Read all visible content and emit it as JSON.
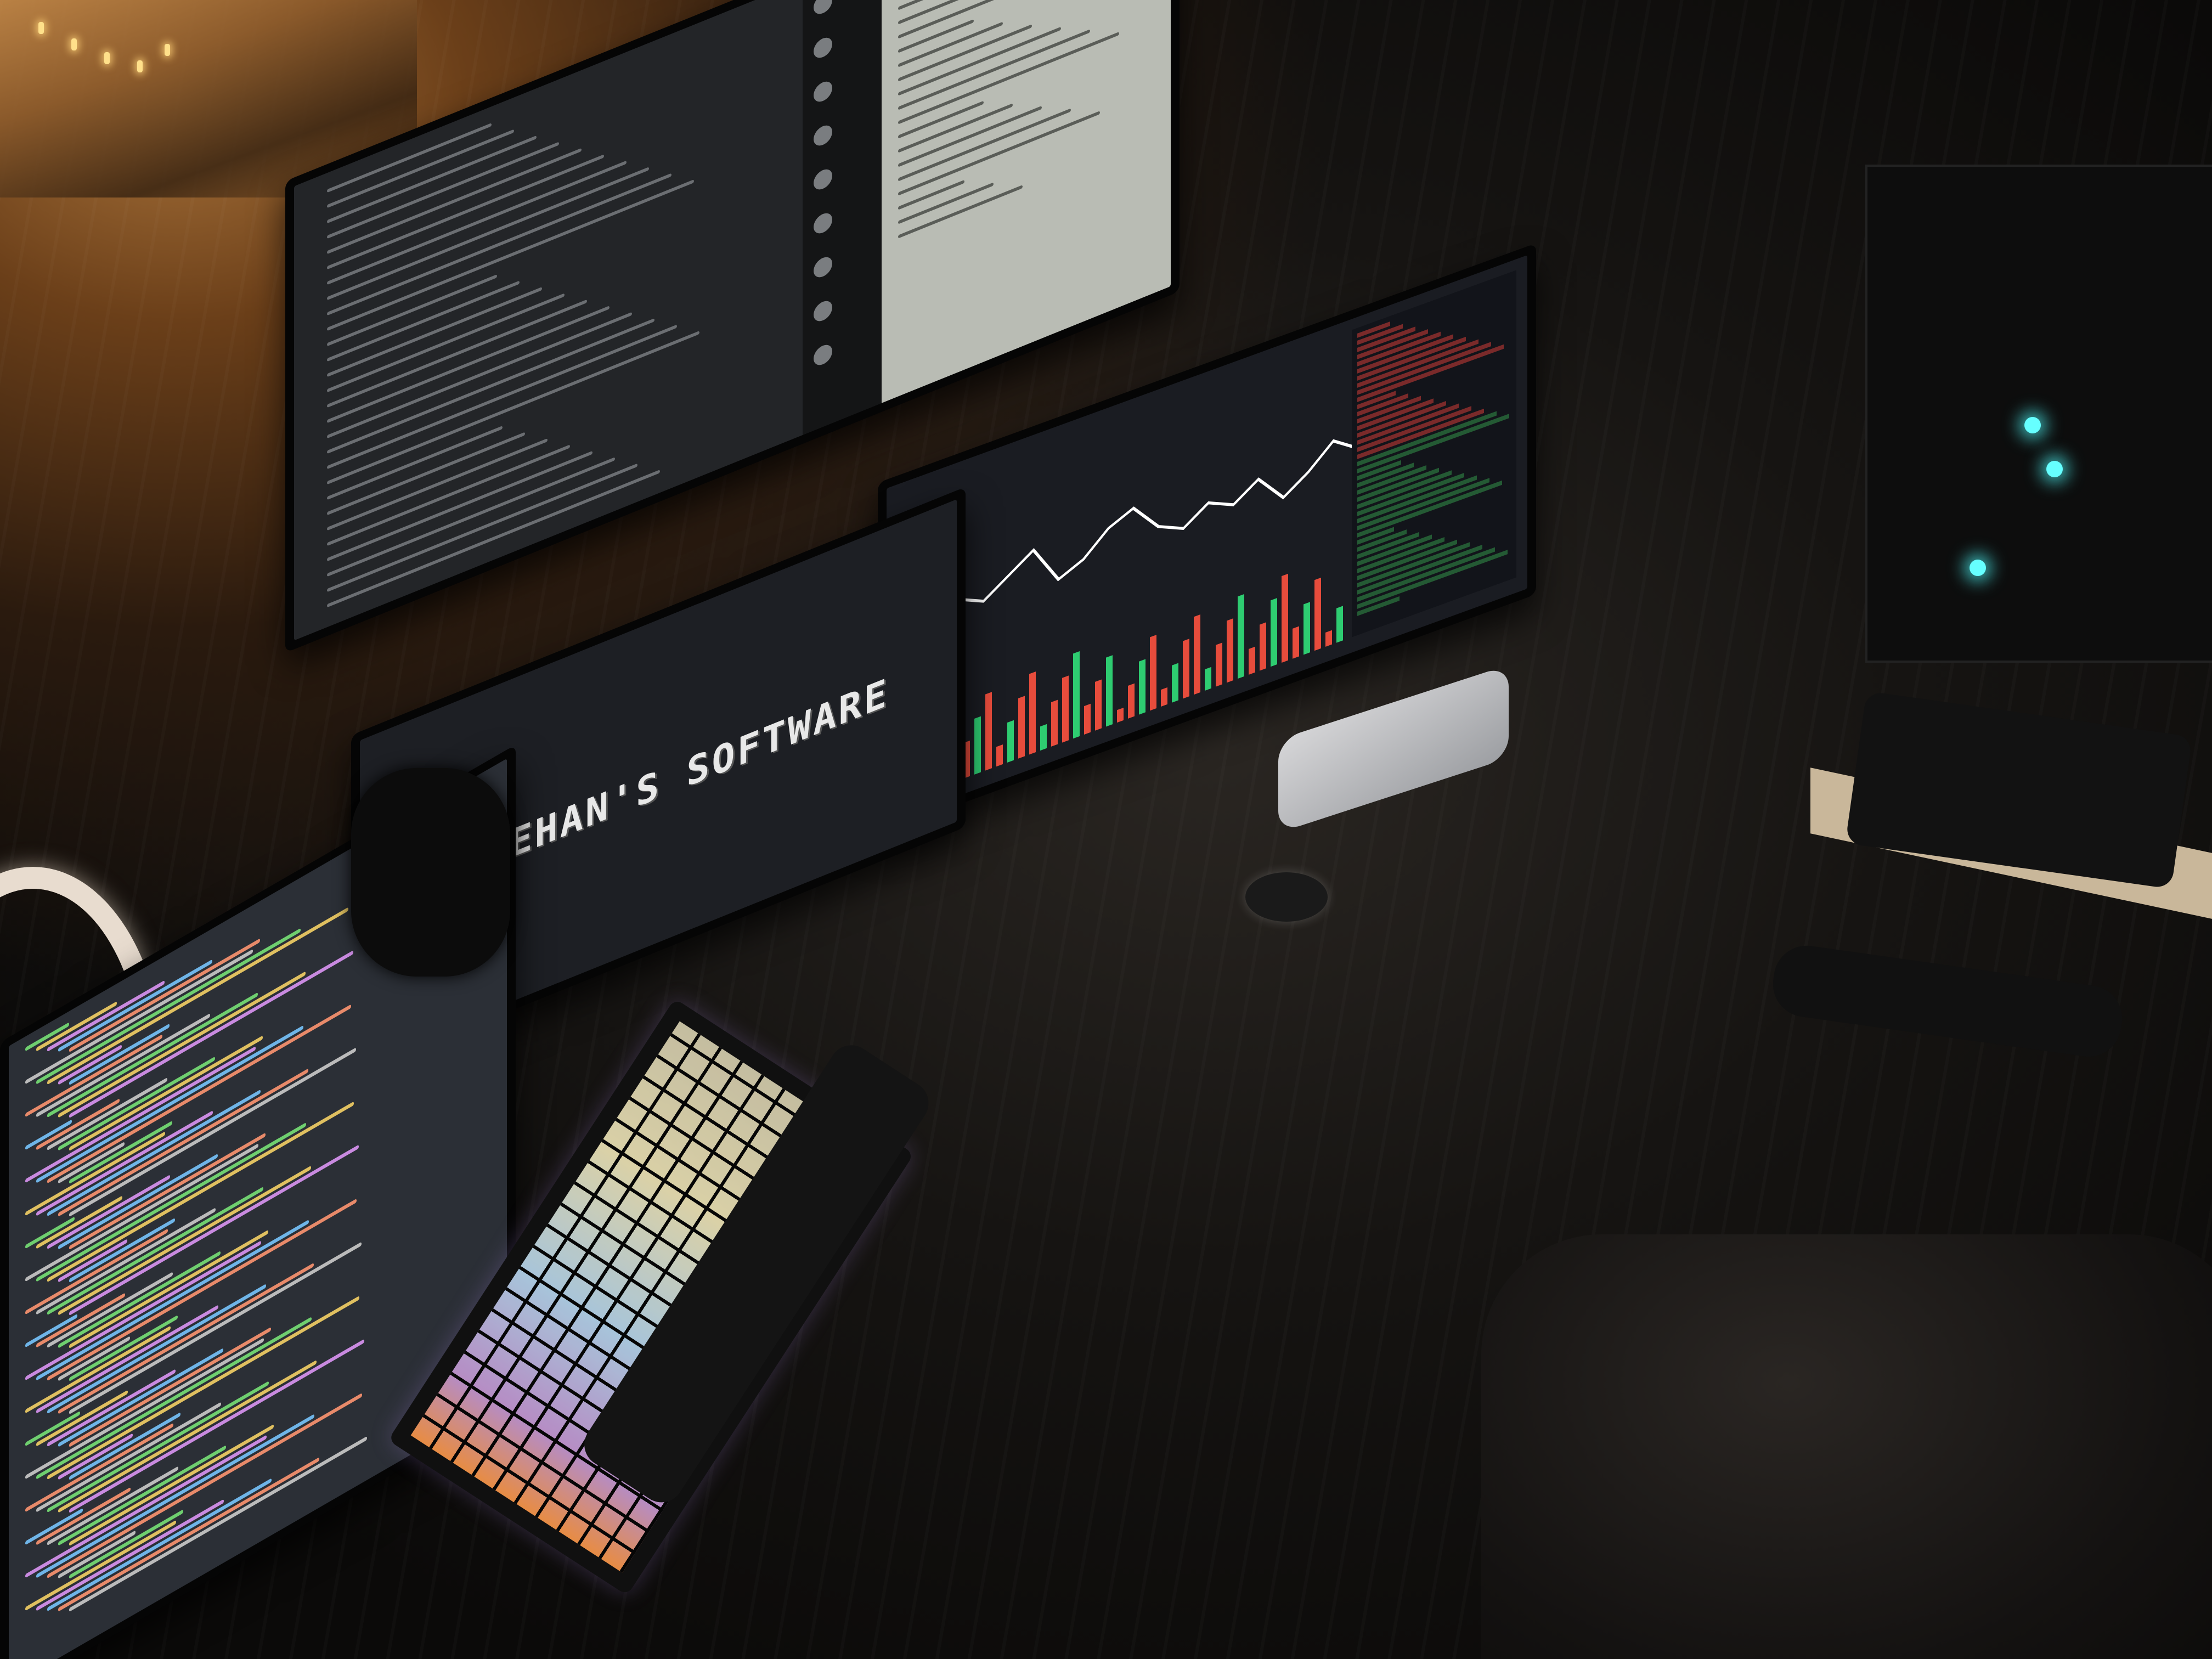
{
  "photo": {
    "subject": "desk setup"
  },
  "banner_text": "LEEHAN'S SOFTWARE",
  "trading_chart": {
    "line_points": [
      60,
      90,
      70,
      50,
      80,
      110,
      40,
      60,
      100,
      120,
      70,
      50,
      80,
      60,
      90,
      40,
      70,
      110,
      80
    ]
  },
  "colors": {
    "screen_bg": "#1a1c22",
    "chart_line": "#ffffff",
    "up": "#2ecc71",
    "down": "#e74c3c"
  }
}
